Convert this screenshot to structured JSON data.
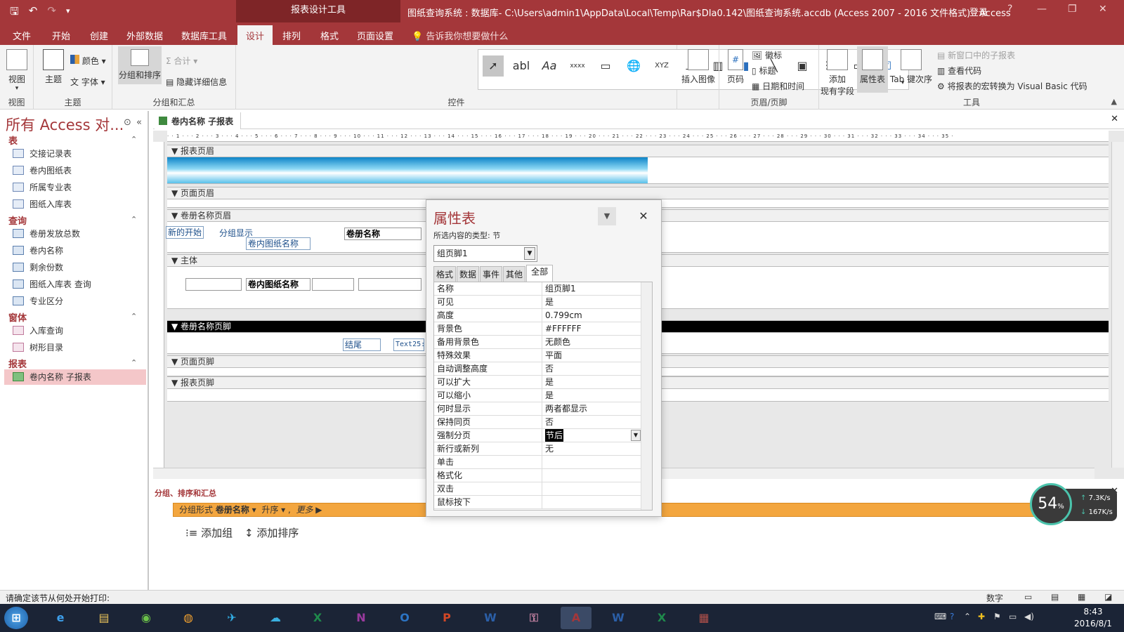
{
  "titlebar": {
    "context_tab": "报表设计工具",
    "window_title": "图纸查询系统 : 数据库- C:\\Users\\admin1\\AppData\\Local\\Temp\\Rar$DIa0.142\\图纸查询系统.accdb (Access 2007 - 2016 文件格式) - Access",
    "login": "登录",
    "help": "?",
    "minimize": "—",
    "restore": "❐",
    "close": "✕"
  },
  "ribbon_tabs": [
    "文件",
    "开始",
    "创建",
    "外部数据",
    "数据库工具",
    "设计",
    "排列",
    "格式",
    "页面设置"
  ],
  "active_tab": "设计",
  "tell_me": "告诉我你想要做什么",
  "ribbon": {
    "view": {
      "label": "视图",
      "group": "视图"
    },
    "theme": {
      "label": "主题",
      "colors": "颜色",
      "fonts": "字体",
      "group": "主题"
    },
    "grouping": {
      "group_sort": "分组和排序",
      "totals": "合计",
      "hide_details": "隐藏详细信息",
      "group": "分组和汇总"
    },
    "controls": {
      "group": "控件",
      "items": [
        "select-tool",
        "abl",
        "Aa",
        "xxxx",
        "page",
        "web",
        "XYZ",
        "break",
        "subform",
        "chart",
        "line",
        "toggle",
        "list",
        "rect",
        "check"
      ]
    },
    "insert_image": "插入图像",
    "header_footer": {
      "page_number": "页码",
      "logo": "徽标",
      "title": "标题",
      "date_time": "日期和时间",
      "group": "页眉/页脚"
    },
    "tools": {
      "add_fields": "添加\n现有字段",
      "property_sheet": "属性表",
      "tab_order": "Tab 键次序",
      "subreport_new_window": "新窗口中的子报表",
      "view_code": "查看代码",
      "convert_macros": "将报表的宏转换为 Visual Basic 代码",
      "group": "工具"
    }
  },
  "nav": {
    "header": "所有 Access 对...",
    "sections": [
      {
        "title": "表",
        "items": [
          "交接记录表",
          "卷内图纸表",
          "所属专业表",
          "图纸入库表"
        ]
      },
      {
        "title": "查询",
        "items": [
          "卷册发放总数",
          "卷内名称",
          "剩余份数",
          "图纸入库表 查询",
          "专业区分"
        ]
      },
      {
        "title": "窗体",
        "items": [
          "入库查询",
          "树形目录"
        ]
      },
      {
        "title": "报表",
        "items": [
          "卷内名称 子报表"
        ]
      }
    ]
  },
  "document": {
    "tab_title": "卷内名称 子报表",
    "ruler": "· · 1 · · · 2 · · · 3 · · · 4 · · · 5 · · · 6 · · · 7 · · · 8 · · · 9 · · · 10 · · · 11 · · · 12 · · · 13 · · · 14 · · · 15 · · · 16 · · · 17 · · · 18 · · · 19 · · · 20 · · · 21 · · · 22 · · · 23 · · · 24 · · · 25 · · · 26 · · · 27 · · · 28 · · · 29 · · · 30 · · · 31 · · · 32 · · · 33 · · · 34 · · · 35 ·",
    "sections": {
      "report_header": "报表页眉",
      "page_header": "页面页眉",
      "group_header": "卷册名称页眉",
      "detail": "主体",
      "group_footer": "卷册名称页脚",
      "page_footer": "页面页脚",
      "report_footer": "报表页脚"
    },
    "controls": {
      "new_start": "新的开始",
      "group_display": "分组显示",
      "volume_name": "卷册名称",
      "drawing_name_header": "卷内图纸名称",
      "drawing_name_detail": "卷内图纸名称",
      "end": "结尾",
      "text25": "Text25:"
    }
  },
  "grouping_pane": {
    "title": "分组、排序和汇总",
    "bar_prefix": "分组形式",
    "bar_field": "卷册名称",
    "bar_order": "升序",
    "bar_more": "更多 ▶",
    "add_group": "添加组",
    "add_sort": "添加排序"
  },
  "property_sheet": {
    "title": "属性表",
    "subtitle": "所选内容的类型: 节",
    "selector": "组页脚1",
    "tabs": [
      "格式",
      "数据",
      "事件",
      "其他",
      "全部"
    ],
    "active_tab": "全部",
    "rows": [
      {
        "key": "名称",
        "value": "组页脚1"
      },
      {
        "key": "可见",
        "value": "是"
      },
      {
        "key": "高度",
        "value": "0.799cm"
      },
      {
        "key": "背景色",
        "value": "#FFFFFF"
      },
      {
        "key": "备用背景色",
        "value": "无颜色"
      },
      {
        "key": "特殊效果",
        "value": "平面"
      },
      {
        "key": "自动调整高度",
        "value": "否"
      },
      {
        "key": "可以扩大",
        "value": "是"
      },
      {
        "key": "可以缩小",
        "value": "是"
      },
      {
        "key": "何时显示",
        "value": "两者都显示"
      },
      {
        "key": "保持同页",
        "value": "否"
      },
      {
        "key": "强制分页",
        "value": "节后"
      },
      {
        "key": "新行或新列",
        "value": "无"
      },
      {
        "key": "单击",
        "value": ""
      },
      {
        "key": "格式化",
        "value": ""
      },
      {
        "key": "双击",
        "value": ""
      },
      {
        "key": "鼠标按下",
        "value": ""
      }
    ]
  },
  "status": {
    "text": "请确定该节从何处开始打印:",
    "mode": "数字"
  },
  "network_widget": {
    "percent": "54",
    "percent_sign": "%",
    "up": "7.3",
    "up_unit": "K/s",
    "down": "167",
    "down_unit": "K/s"
  },
  "taskbar": {
    "time": "8:43",
    "date": "2016/8/1"
  }
}
